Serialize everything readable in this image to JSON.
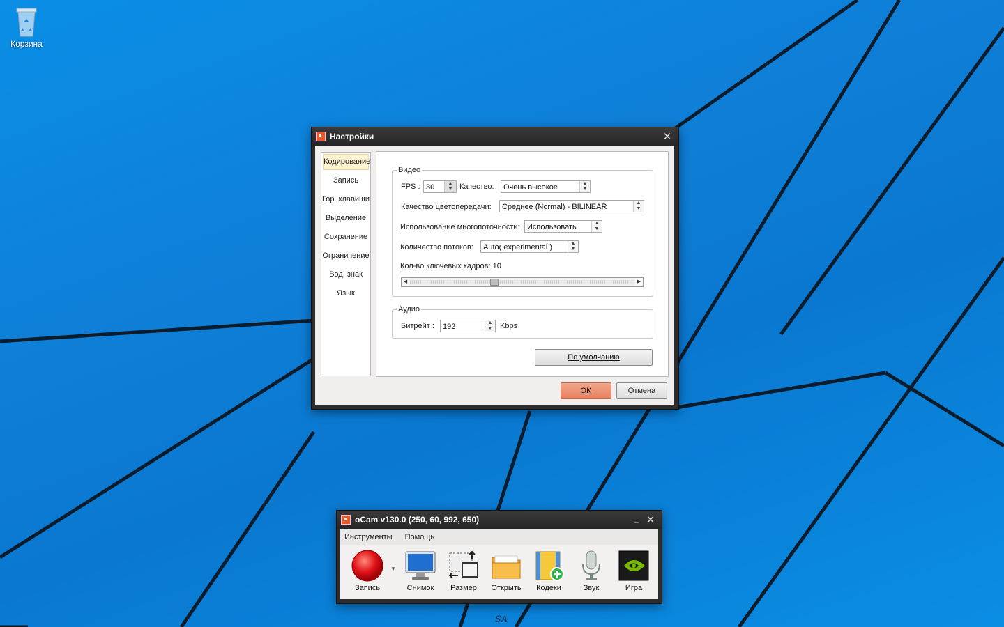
{
  "desktop": {
    "recycle_bin_label": "Корзина",
    "bottom_mark": "SA"
  },
  "settings": {
    "title": "Настройки",
    "nav_items": [
      {
        "label": "Кодирование",
        "selected": true
      },
      {
        "label": "Запись"
      },
      {
        "label": "Гор. клавиши"
      },
      {
        "label": "Выделение"
      },
      {
        "label": "Сохранение"
      },
      {
        "label": "Ограничение"
      },
      {
        "label": "Вод. знак"
      },
      {
        "label": "Язык"
      }
    ],
    "video": {
      "legend": "Видео",
      "fps_label": "FPS :",
      "fps_value": "30",
      "quality_label": "Качество:",
      "quality_value": "Очень высокое",
      "color_label": "Качество цветопередачи:",
      "color_value": "Среднее (Normal) - BILINEAR",
      "multithread_label": "Использование многопоточности:",
      "multithread_value": "Использовать",
      "threads_label": "Количество потоков:",
      "threads_value": "Auto( experimental )",
      "keyframes_label": "Кол-во ключевых кадров:",
      "keyframes_value": "10",
      "keyframes_slider_fraction": 0.37
    },
    "audio": {
      "legend": "Аудио",
      "bitrate_label": "Битрейт :",
      "bitrate_value": "192",
      "bitrate_unit": "Kbps"
    },
    "default_button": "По умолчанию",
    "ok_button": "OK",
    "cancel_button": "Отмена"
  },
  "ocam": {
    "title": "oCam v130.0 (250, 60, 992, 650)",
    "menu": [
      "Инструменты",
      "Помощь"
    ],
    "tools": [
      {
        "label": "Запись",
        "icon": "record-icon"
      },
      {
        "label": "Снимок",
        "icon": "monitor-icon"
      },
      {
        "label": "Размер",
        "icon": "resize-icon"
      },
      {
        "label": "Открыть",
        "icon": "folder-icon"
      },
      {
        "label": "Кодеки",
        "icon": "codec-icon"
      },
      {
        "label": "Звук",
        "icon": "microphone-icon"
      },
      {
        "label": "Игра",
        "icon": "nvidia-icon"
      }
    ]
  }
}
